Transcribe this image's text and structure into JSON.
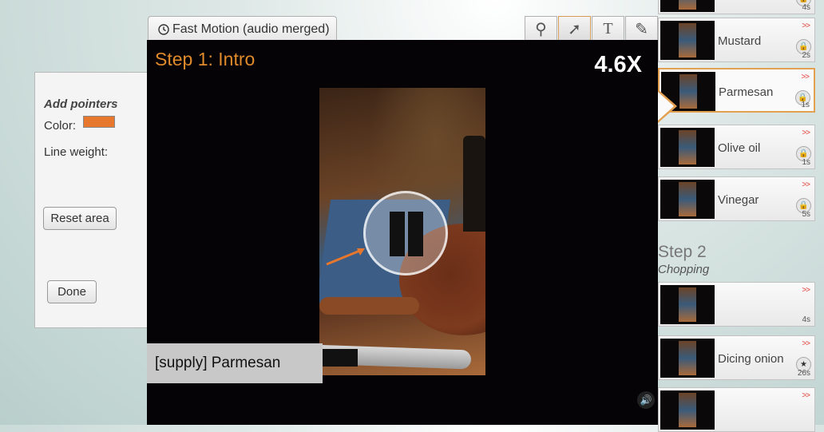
{
  "left_panel": {
    "title": "Add pointers",
    "color_label": "Color:",
    "color_value": "#e8772e",
    "line_weight_label": "Line weight:",
    "reset_label": "Reset area",
    "done_label": "Done"
  },
  "tab": {
    "label": "Fast Motion (audio merged)",
    "icon": "clock-icon"
  },
  "tools": [
    {
      "icon": "search-icon",
      "glyph": "⚲"
    },
    {
      "icon": "arrow-icon",
      "glyph": "➚"
    },
    {
      "icon": "text-icon",
      "glyph": "T"
    },
    {
      "icon": "pencil-icon",
      "glyph": "✎"
    }
  ],
  "video": {
    "step_title": "Step 1: Intro",
    "speed": "4.6X",
    "caption": "[supply] Parmesan",
    "pointer_color": "#e8772e",
    "volume_glyph": "🔊"
  },
  "clips_step1": [
    {
      "name": "",
      "dur": "4s",
      "arr": "",
      "icon": "lock-icon"
    },
    {
      "name": "Mustard",
      "dur": "2s",
      "arr": ">>",
      "icon": "lock-icon"
    },
    {
      "name": "Parmesan",
      "dur": "1s",
      "arr": ">>",
      "icon": "lock-icon",
      "selected": true
    },
    {
      "name": "Olive oil",
      "dur": "1s",
      "arr": ">>",
      "icon": "lock-icon"
    },
    {
      "name": "Vinegar",
      "dur": "5s",
      "arr": ">>",
      "icon": "lock-icon"
    }
  ],
  "step2": {
    "title": "Step 2",
    "subtitle": "Chopping"
  },
  "clips_step2": [
    {
      "name": "",
      "dur": "4s",
      "arr": ">>"
    },
    {
      "name": "Dicing onion",
      "dur": "26s",
      "arr": ">>",
      "icon": "star-icon"
    },
    {
      "name": "",
      "dur": "",
      "arr": ">>"
    }
  ],
  "colors": {
    "accent": "#e08a2c",
    "selected_border": "#e3a050",
    "arrows": "#e0413a"
  }
}
